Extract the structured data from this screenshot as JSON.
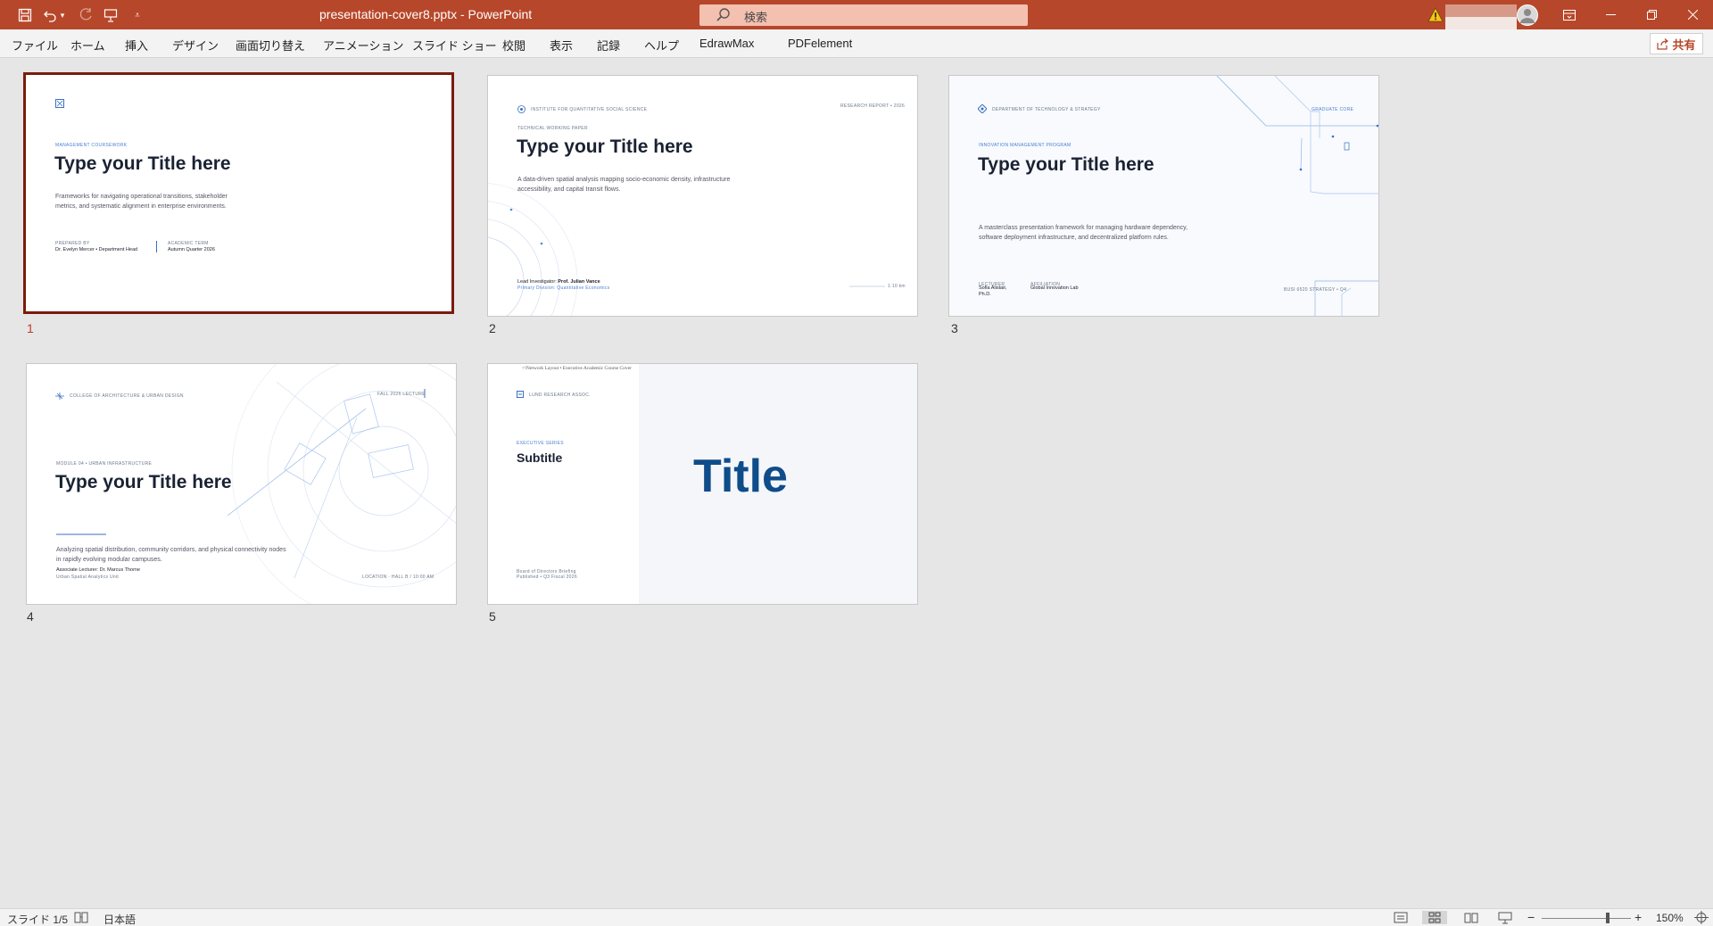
{
  "app": {
    "doc_title": "presentation-cover8.pptx  -  PowerPoint",
    "search_placeholder": "検索",
    "share_label": "共有"
  },
  "menu": [
    "ファイル",
    "ホーム",
    "挿入",
    "デザイン",
    "画面切り替え",
    "アニメーション",
    "スライド ショー",
    "校閲",
    "表示",
    "記録",
    "ヘルプ",
    "EdrawMax",
    "PDFelement"
  ],
  "slides": [
    {
      "number": "1",
      "eyebrow": "MANAGEMENT COURSEWORK",
      "title": "Type your Title here",
      "body": [
        "Frameworks for navigating operational transitions, stakeholder",
        "metrics, and systematic alignment in enterprise environments."
      ],
      "prepared_by_label": "PREPARED BY",
      "prepared_by": "Dr. Evelyn Mercer • Department Head",
      "term_label": "ACADEMIC TERM",
      "term": "Autumn Quarter 2026"
    },
    {
      "number": "2",
      "institute": "INSTITUTE FOR QUANTITATIVE SOCIAL SCIENCE",
      "report": "RESEARCH REPORT • 2026",
      "eyebrow": "TECHNICAL WORKING PAPER",
      "title": "Type your Title here",
      "body": [
        "A data-driven spatial analysis mapping socio-economic density, infrastructure",
        "accessibility, and capital transit flows."
      ],
      "lead_prefix": "Lead Investigator: ",
      "lead_name": "Prof. Julian Vance",
      "division": "Primary Division: Quantitative Economics",
      "scale": "1:10 km"
    },
    {
      "number": "3",
      "department": "DEPARTMENT OF TECHNOLOGY & STRATEGY",
      "badge": "GRADUATE CORE",
      "eyebrow": "INNOVATION MANAGEMENT PROGRAM",
      "title": "Type your Title here",
      "body": [
        "A masterclass presentation framework for managing hardware dependency,",
        "software deployment infrastructure, and decentralized platform rules."
      ],
      "lecturer_label": "LECTURER",
      "lecturer": [
        "Sofia Alistair,",
        "Ph.D."
      ],
      "affiliation_label": "AFFILIATION",
      "affiliation": "Global Innovation Lab",
      "footer": "BUSI 6520 STRATEGY • Q4"
    },
    {
      "number": "4",
      "college": "COLLEGE OF ARCHITECTURE & URBAN DESIGN",
      "lecture": "FALL 2026 LECTURE",
      "eyebrow": "MODULE 04 • URBAN INFRASTRUCTURE",
      "title": "Type your Title here",
      "body": [
        "Analyzing spatial distribution, community corridors, and physical connectivity nodes",
        "in rapidly evolving modular campuses."
      ],
      "lecturer": "Associate Lecturer: Dr. Marcus Thorne",
      "lab": "Urban Spatial Analytics Unit",
      "location": "LOCATION · HALL B / 10:00 AM"
    },
    {
      "number": "5",
      "header_note": "<!Network Layout • Executive Academic Course Cover",
      "org": "LUND RESEARCH ASSOC.",
      "eyebrow": "EXECUTIVE SERIES",
      "subtitle": "Subtitle",
      "title": "Title",
      "footer": [
        "Board of Directors Briefing",
        "Published • Q3 Fiscal 2026"
      ]
    }
  ],
  "status": {
    "slide_info": "スライド 1/5",
    "language": "日本語",
    "zoom": "150%"
  },
  "colors": {
    "accent": "#b7472a",
    "selected_border": "#7a1c0c",
    "slide_title": "#1a2233",
    "slide5_title": "#0f4c8a"
  }
}
